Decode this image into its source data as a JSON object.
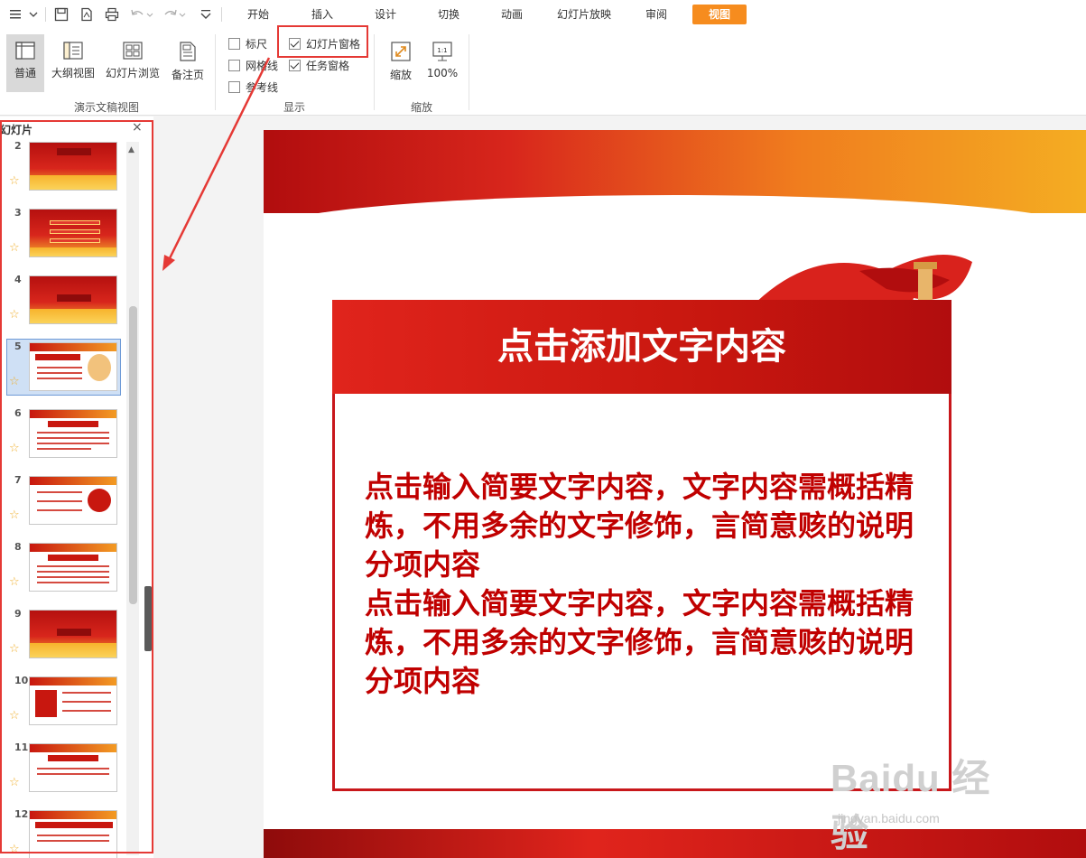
{
  "toolbar": {
    "tabs": [
      "开始",
      "插入",
      "设计",
      "切换",
      "动画",
      "幻灯片放映",
      "审阅",
      "视图"
    ],
    "active_tab": "视图",
    "accent_color": "#f68c1e"
  },
  "ribbon": {
    "view_buttons": [
      "普通",
      "大纲视图",
      "幻灯片浏览",
      "备注页"
    ],
    "view_group_label": "演示文稿视图",
    "show_checks": [
      {
        "label": "标尺",
        "checked": false
      },
      {
        "label": "幻灯片窗格",
        "checked": true
      },
      {
        "label": "网格线",
        "checked": false
      },
      {
        "label": "任务窗格",
        "checked": true
      },
      {
        "label": "参考线",
        "checked": false
      }
    ],
    "show_group_label": "显示",
    "zoom_buttons": [
      "缩放",
      "100%"
    ],
    "zoom_group_label": "缩放"
  },
  "pane": {
    "title": "幻灯片",
    "close_glyph": "×",
    "slide_numbers": [
      "2",
      "3",
      "4",
      "5",
      "6",
      "7",
      "8",
      "9",
      "10",
      "11",
      "12"
    ],
    "selected_slide": "5"
  },
  "slide": {
    "title": "点击添加文字内容",
    "body": "点击输入简要文字内容，文字内容需概括精炼，不用多余的文字修饰，言简意赅的说明分项内容\n点击输入简要文字内容，文字内容需概括精炼，不用多余的文字修饰，言简意赅的说明分项内容"
  },
  "annotation": {
    "highlight_color": "#e53935"
  },
  "watermark": {
    "brand": "Baidu 经验",
    "url": "jingyan.baidu.com"
  }
}
